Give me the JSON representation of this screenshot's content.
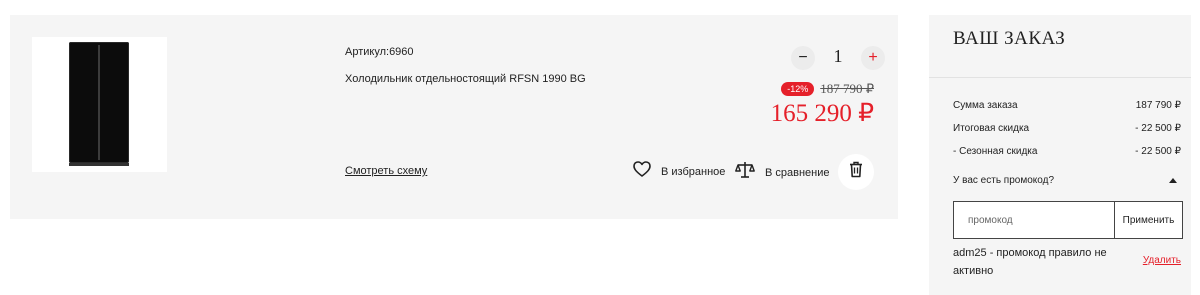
{
  "cart_item": {
    "article": "Артикул:6960",
    "name": "Холодильник отдельностоящий RFSN 1990 BG",
    "quantity": "1",
    "discount_badge": "-12%",
    "old_price": "187 790 ₽",
    "price": "165 290 ₽",
    "scheme_link": "Смотреть схему",
    "favorite_label": "В избранное",
    "compare_label": "В сравнение"
  },
  "order": {
    "title": "ВАШ ЗАКАЗ",
    "rows": [
      {
        "label": "Сумма заказа",
        "value": "187 790 ₽"
      },
      {
        "label": "Итоговая скидка",
        "value": "- 22 500 ₽"
      },
      {
        "label": "- Сезонная скидка",
        "value": "- 22 500 ₽"
      }
    ],
    "promo_question": "У вас есть промокод?",
    "promo_placeholder": "промокод",
    "promo_apply": "Применить",
    "promo_status": "adm25 - промокод правило не активно",
    "promo_remove": "Удалить"
  },
  "colors": {
    "accent": "#e5202a",
    "card_bg": "#f5f5f5"
  },
  "icons": [
    "minus-icon",
    "plus-icon",
    "heart-icon",
    "scales-icon",
    "trash-icon",
    "caret-up-icon"
  ]
}
